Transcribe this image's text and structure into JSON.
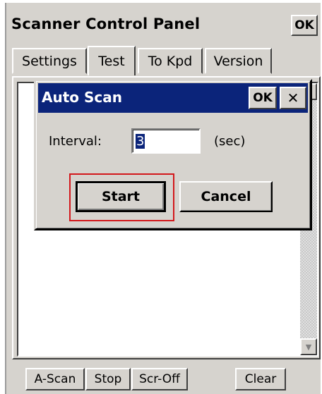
{
  "app": {
    "title": "Scanner Control Panel",
    "ok_label": "OK"
  },
  "tabs": [
    {
      "label": "Settings"
    },
    {
      "label": "Test",
      "active": true
    },
    {
      "label": "To Kpd"
    },
    {
      "label": "Version"
    }
  ],
  "bottom_buttons": [
    {
      "label": "A-Scan"
    },
    {
      "label": "Stop"
    },
    {
      "label": "Scr-Off"
    },
    {
      "label": "Clear"
    }
  ],
  "dialog": {
    "title": "Auto Scan",
    "ok_label": "OK",
    "close_glyph": "✕",
    "interval_label": "Interval:",
    "interval_value": "3",
    "unit_label": "(sec)",
    "start_label": "Start",
    "cancel_label": "Cancel"
  },
  "icons": {
    "scroll_up": "arrow-up-icon",
    "scroll_down": "arrow-down-icon"
  },
  "colors": {
    "dialog_title_bg": "#0b247a",
    "highlight_outline": "#d3171b",
    "chrome": "#d6d3ce"
  }
}
